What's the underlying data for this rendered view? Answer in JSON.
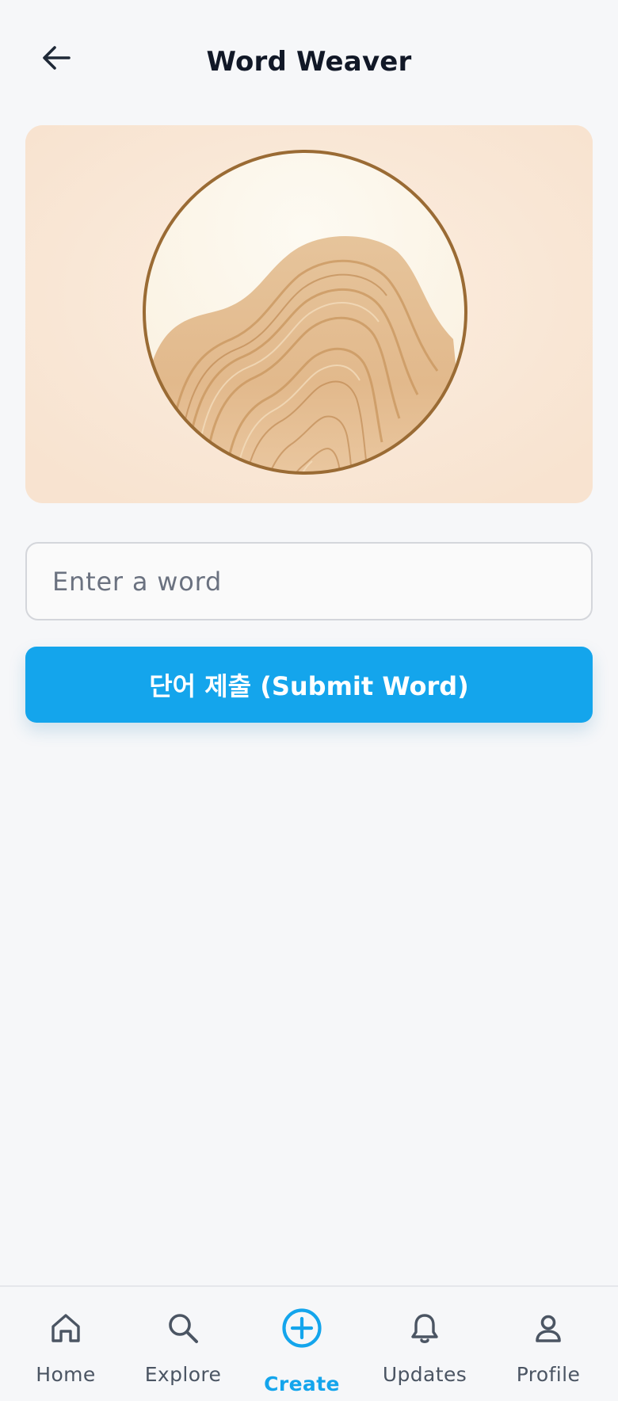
{
  "header": {
    "title": "Word Weaver",
    "back_icon": "arrow-left-icon"
  },
  "hero": {
    "image": "wood-grain-circle-illustration"
  },
  "form": {
    "input_placeholder": "Enter a word",
    "input_value": "",
    "submit_label": "단어 제출 (Submit Word)"
  },
  "colors": {
    "accent": "#14a5ec",
    "background": "#f6f7f9",
    "hero_background": "#f9e6d4",
    "title_text": "#111827",
    "nav_inactive": "#4b5563"
  },
  "nav": {
    "items": [
      {
        "label": "Home",
        "icon": "home-icon",
        "active": false
      },
      {
        "label": "Explore",
        "icon": "search-icon",
        "active": false
      },
      {
        "label": "Create",
        "icon": "plus-circle-icon",
        "active": true
      },
      {
        "label": "Updates",
        "icon": "bell-icon",
        "active": false
      },
      {
        "label": "Profile",
        "icon": "user-icon",
        "active": false
      }
    ]
  }
}
